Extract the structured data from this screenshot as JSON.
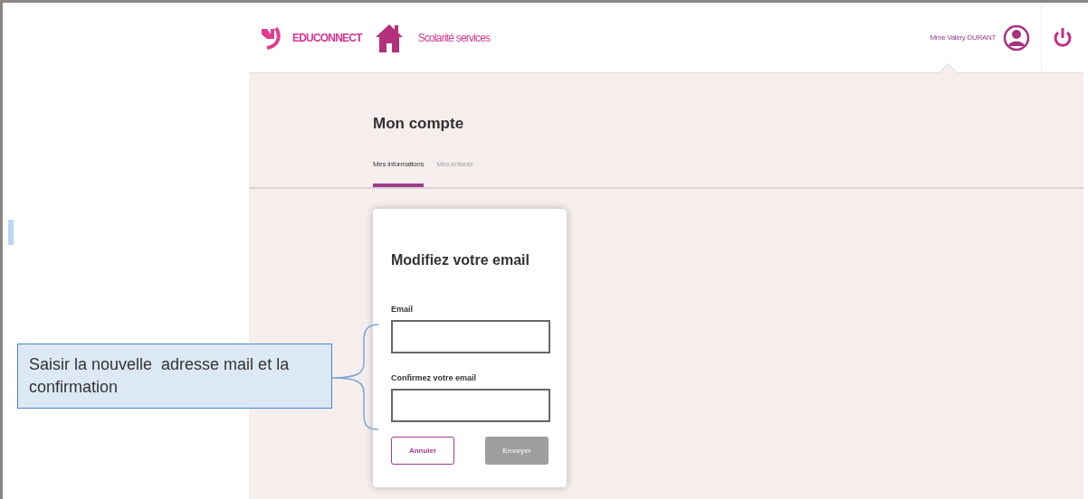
{
  "header": {
    "brand": "EDUCONNECT",
    "service": "Scolarité services",
    "user": "Mme Valéry DURANT"
  },
  "page": {
    "title": "Mon compte"
  },
  "tabs": [
    {
      "label": "Mes informations",
      "selected": true
    },
    {
      "label": "Mes enfants",
      "selected": false
    }
  ],
  "dialog": {
    "title": "Modifiez votre email",
    "fields": [
      {
        "label": "Email"
      },
      {
        "label": "Confirmez votre email"
      }
    ],
    "buttons": [
      {
        "label": "Annuler",
        "kind": "secondary",
        "disabled": false
      },
      {
        "label": "Envoyer",
        "kind": "primary",
        "disabled": true
      }
    ]
  },
  "callout": {
    "text": "Saisir la nouvelle  adresse mail et la confirmation"
  }
}
